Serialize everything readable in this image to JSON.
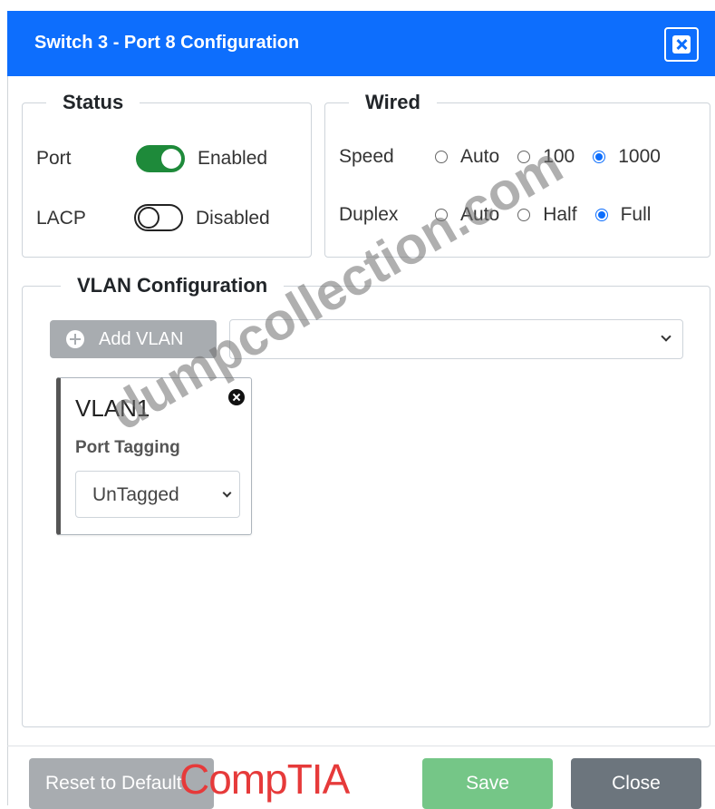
{
  "dialog": {
    "title": "Switch 3 - Port 8 Configuration",
    "close_icon": "close-icon",
    "accent_color": "#0d6efd"
  },
  "status": {
    "legend": "Status",
    "port": {
      "label": "Port",
      "state": "Enabled",
      "on": true
    },
    "lacp": {
      "label": "LACP",
      "state": "Disabled",
      "on": false
    }
  },
  "wired": {
    "legend": "Wired",
    "speed": {
      "label": "Speed",
      "options": [
        "Auto",
        "100",
        "1000"
      ],
      "selected": "1000"
    },
    "duplex": {
      "label": "Duplex",
      "options": [
        "Auto",
        "Half",
        "Full"
      ],
      "selected": "Full"
    }
  },
  "vlan": {
    "legend": "VLAN Configuration",
    "add_label": "Add VLAN",
    "select_value": "",
    "cards": [
      {
        "name": "VLAN1",
        "tagging_label": "Port Tagging",
        "tagging_value": "UnTagged"
      }
    ]
  },
  "footer": {
    "reset_label": "Reset to Default",
    "save_label": "Save",
    "close_label": "Close"
  },
  "overlay": {
    "brand_logo": "CompTIA",
    "watermark": "dumpcollection.com"
  }
}
